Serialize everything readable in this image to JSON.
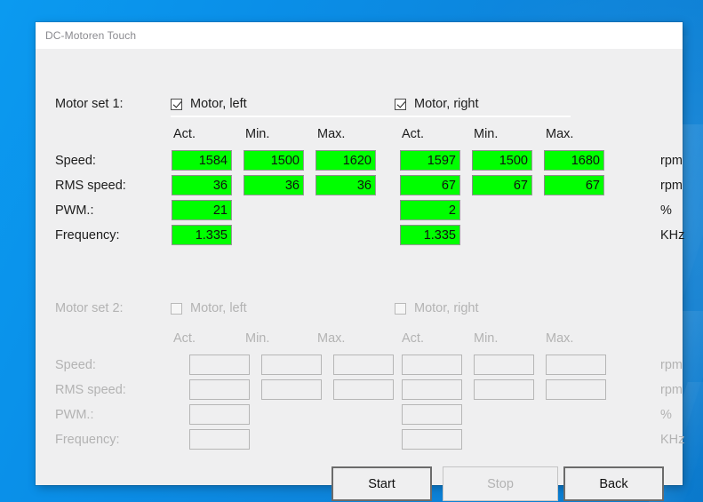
{
  "window": {
    "title": "DC-Motoren Touch"
  },
  "sets": [
    {
      "name": "Motor set 1:",
      "enabled": true,
      "left_checkbox": {
        "label": "Motor, left",
        "checked": true
      },
      "right_checkbox": {
        "label": "Motor, right",
        "checked": true
      },
      "column_headers": [
        "Act.",
        "Min.",
        "Max.",
        "Act.",
        "Min.",
        "Max."
      ],
      "rows": [
        {
          "label": "Speed:",
          "unit": "rpm",
          "values": [
            "1584",
            "1500",
            "1620",
            "1597",
            "1500",
            "1680"
          ]
        },
        {
          "label": "RMS speed:",
          "unit": "rpm",
          "values": [
            "36",
            "36",
            "36",
            "67",
            "67",
            "67"
          ]
        },
        {
          "label": "PWM.:",
          "unit": "%",
          "values": [
            "21",
            "",
            "",
            "2",
            "",
            ""
          ]
        },
        {
          "label": "Frequency:",
          "unit": "KHz",
          "values": [
            "1.335",
            "",
            "",
            "1.335",
            "",
            ""
          ]
        }
      ]
    },
    {
      "name": "Motor set 2:",
      "enabled": false,
      "left_checkbox": {
        "label": "Motor, left",
        "checked": false
      },
      "right_checkbox": {
        "label": "Motor, right",
        "checked": false
      },
      "column_headers": [
        "Act.",
        "Min.",
        "Max.",
        "Act.",
        "Min.",
        "Max."
      ],
      "rows": [
        {
          "label": "Speed:",
          "unit": "rpm",
          "values": [
            "",
            "",
            "",
            "",
            "",
            ""
          ]
        },
        {
          "label": "RMS speed:",
          "unit": "rpm",
          "values": [
            "",
            "",
            "",
            "",
            "",
            ""
          ]
        },
        {
          "label": "PWM.:",
          "unit": "%",
          "values": [
            "",
            "",
            "",
            "",
            "",
            ""
          ]
        },
        {
          "label": "Frequency:",
          "unit": "KHz",
          "values": [
            "",
            "",
            "",
            "",
            "",
            ""
          ]
        }
      ]
    }
  ],
  "buttons": {
    "start": "Start",
    "stop": "Stop",
    "back": "Back"
  },
  "colors": {
    "active_field": "#00ff00",
    "window_background": "#efeff0",
    "titlebar": "#ffffff",
    "desktop": "#0a8fe8"
  }
}
